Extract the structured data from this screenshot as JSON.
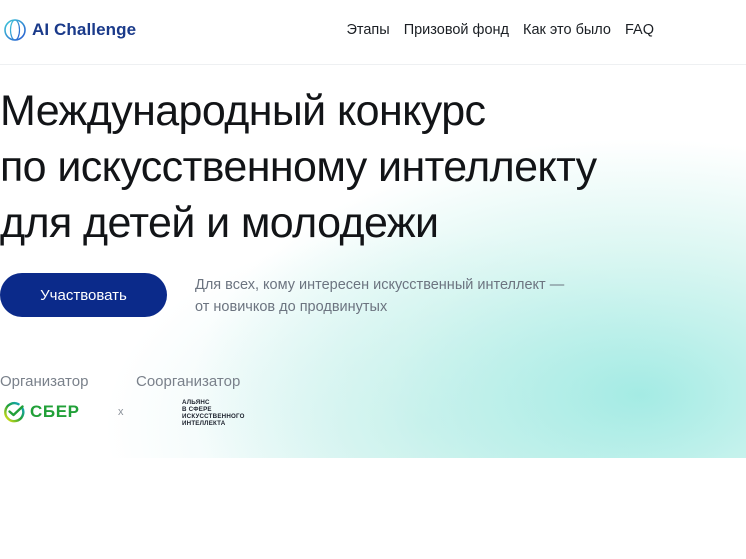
{
  "header": {
    "logo_text": "AI Challenge",
    "nav": [
      "Этапы",
      "Призовой фонд",
      "Как это было",
      "FAQ"
    ]
  },
  "hero": {
    "headline": [
      "Международный конкурс",
      "по искусственному интеллекту",
      "для детей и молодежи"
    ],
    "cta_label": "Участвовать",
    "subtext": [
      "Для всех, кому интересен искусственный интеллект —",
      "от новичков до продвинутых"
    ]
  },
  "organizers": {
    "organizer_label": "Организатор",
    "coorganizer_label": "Соорганизатор",
    "sber_text": "СБЕР",
    "separator": "x",
    "alliance_text": [
      "АЛЬЯНС",
      "В СФЕРЕ",
      "ИСКУССТВЕННОГО",
      "ИНТЕЛЛЕКТА"
    ]
  },
  "colors": {
    "brand_navy": "#0b2a8a",
    "logo_blue": "#1a3a8a",
    "sber_green": "#21a038",
    "hero_mint": "#96e8e0"
  }
}
